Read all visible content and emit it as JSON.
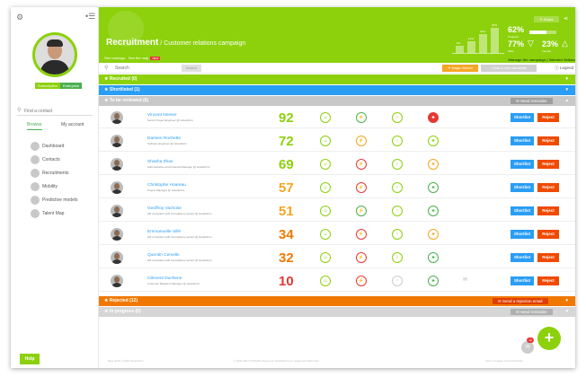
{
  "sidebar": {
    "subscription": [
      "Subscription",
      "Enterprise"
    ],
    "find_placeholder": "Find a contact",
    "tabs": [
      "Browse",
      "My account"
    ],
    "nav": [
      "Dashboard",
      "Contacts",
      "Recruitments",
      "Mobility",
      "Predictive models",
      "Talent Map"
    ],
    "help": "Help"
  },
  "header": {
    "title_bold": "Recruitment",
    "title_rest": " / Customer relations campaign",
    "links": [
      "See rankings",
      "See the map"
    ],
    "links_badge": "NEW",
    "share": "Share",
    "bars": [
      {
        "value": "9%",
        "level": 0.3
      },
      {
        "value": "14%",
        "level": 0.45
      },
      {
        "value": "22%",
        "level": 0.75
      },
      {
        "value": "30%",
        "level": 1.0
      }
    ],
    "progress_pct": "62%",
    "progress_label": "Progress",
    "male_pct": "77%",
    "male_label": "Male",
    "female_pct": "23%",
    "female_label": "Female",
    "manage_link": "Manage the campaign | Valentin Sellam"
  },
  "searchbar": {
    "placeholder": "Search",
    "button": "Search",
    "magic": "Magic Button",
    "add": "Add a new candidate",
    "legend": "Legend"
  },
  "sections": {
    "recruited": "Recruited (0)",
    "shortlisted": "Shortlisted (1)",
    "to_review": "To be reviewed (8)",
    "to_review_action": "Send reminder",
    "rejected": "Rejected (12)",
    "rejected_action": "Send a rejection email",
    "in_progress": "In progress (0)",
    "in_progress_action": "Send reminder"
  },
  "rows": [
    {
      "name": "Vincent Neeser",
      "title": "Senior Project Engineer @ HotelsFirm",
      "score": "92",
      "score_color": "#8cd10b",
      "c": [
        "#8cd10b",
        "#4caf50",
        "#8cd10b",
        "#e53935"
      ]
    },
    {
      "name": "Damien Rochette",
      "title": "Software Engineer @ HotelsFirm",
      "score": "72",
      "score_color": "#8cd10b",
      "c": [
        "#8cd10b",
        "#f5a623",
        "#8cd10b",
        "#8cd10b"
      ]
    },
    {
      "name": "Shasha Zhao",
      "title": "Administrative and Financial Manager @ HotelsFirm",
      "score": "69",
      "score_color": "#8cd10b",
      "c": [
        "#8cd10b",
        "#e53935",
        "#8cd10b",
        "#f5a623"
      ]
    },
    {
      "name": "Christophe Hoareau",
      "title": "Project Manager @ HotelsFirm",
      "score": "57",
      "score_color": "#f5a623",
      "c": [
        "#8cd10b",
        "#e53935",
        "#8cd10b",
        "#4caf50"
      ]
    },
    {
      "name": "Geoffroy Vachose",
      "title": "HR consultant (HR Consultancy sector) @ HotelsFirm",
      "score": "51",
      "score_color": "#f5a623",
      "c": [
        "#8cd10b",
        "#4caf50",
        "#8cd10b",
        "#4caf50"
      ]
    },
    {
      "name": "Emmanuelle Sillé",
      "title": "HR consultant (HR Consultancy sector) @ HotelsFirm",
      "score": "34",
      "score_color": "#f07800",
      "c": [
        "#8cd10b",
        "#e53935",
        "#8cd10b",
        "#f5a623"
      ]
    },
    {
      "name": "Quentin Cervelle",
      "title": "HR consultant (HR Consultancy sector) @ HotelsFirm",
      "score": "32",
      "score_color": "#f07800",
      "c": [
        "#8cd10b",
        "#e53935",
        "#8cd10b",
        "#4caf50"
      ]
    },
    {
      "name": "Clément Duchene",
      "title": "Customer Relations Manager @ HotelsFirm",
      "score": "10",
      "score_color": "#e53935",
      "c": [
        "#8cd10b",
        "#e53935",
        "#cccccc",
        "#4caf50"
      ]
    }
  ],
  "row_buttons": {
    "shortlist": "Shortlist",
    "reject": "Reject"
  },
  "footer": {
    "left": "Beta 2015 © 2015 HotelsFirm",
    "mid": "© 2015-2017 All Rights Reserved, HotelsFirm is a registered trademark",
    "right": "CGU | Cookies | Personal Data"
  },
  "chat_badge": "10"
}
